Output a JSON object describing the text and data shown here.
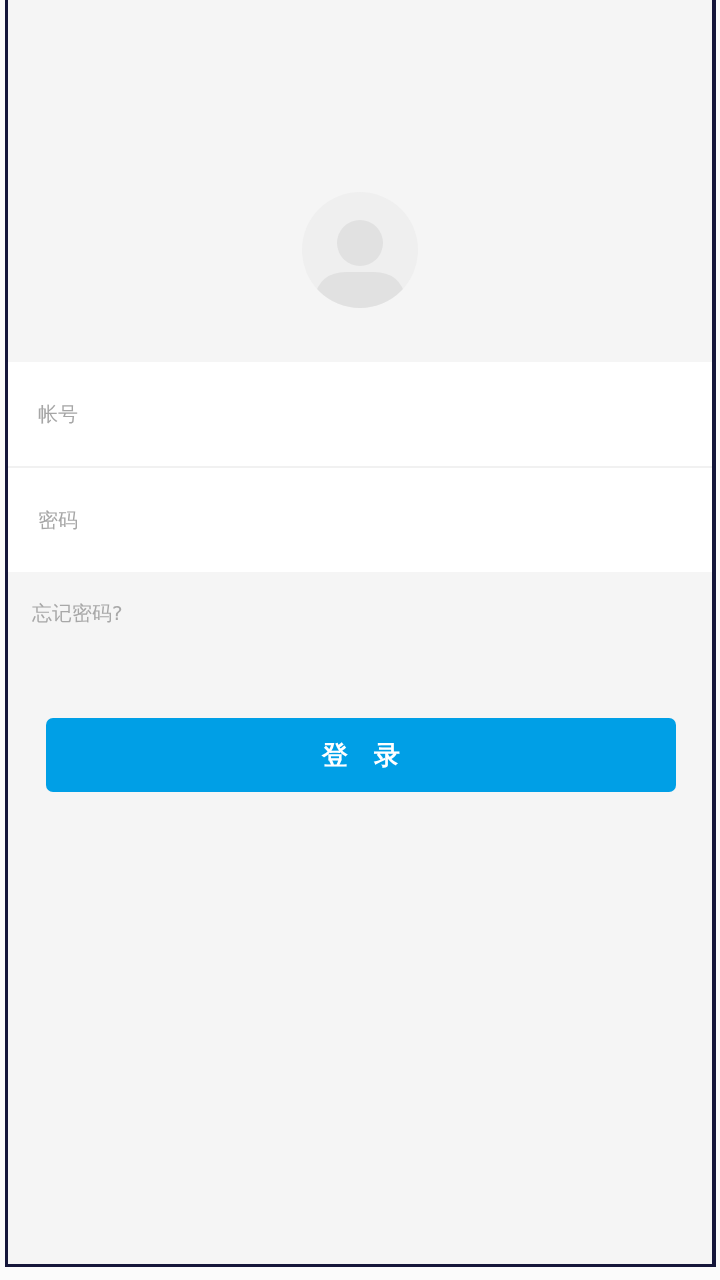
{
  "fields": [
    {
      "placeholder": "帐号"
    },
    {
      "placeholder": "密码"
    }
  ],
  "forgot_link": "忘记密码?",
  "login_button": "登　录"
}
